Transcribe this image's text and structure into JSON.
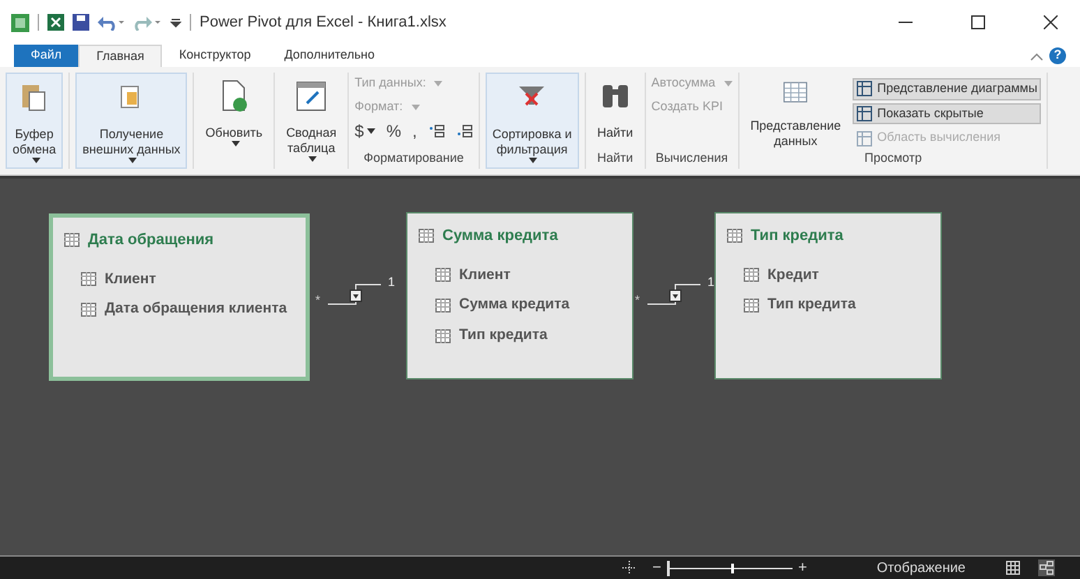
{
  "window": {
    "title": "Power Pivot для Excel - Книга1.xlsx",
    "help": "?"
  },
  "tabs": [
    {
      "label": "Файл",
      "kind": "file",
      "selected": false
    },
    {
      "label": "Главная",
      "kind": "tab",
      "selected": true
    },
    {
      "label": "Конструктор",
      "kind": "tab",
      "selected": false
    },
    {
      "label": "Дополнительно",
      "kind": "tab",
      "selected": false
    }
  ],
  "ribbon": {
    "groups": [
      {
        "controls": [
          {
            "kind": "large",
            "label": "Буфер\nобмена",
            "dropdown": true,
            "highlighted": true
          }
        ]
      },
      {
        "controls": [
          {
            "kind": "large",
            "label": "Получение\nвнешних данных",
            "dropdown": true,
            "highlighted": true
          }
        ]
      },
      {
        "controls": [
          {
            "kind": "large",
            "label": "Обновить",
            "dropdown": true,
            "highlighted": false
          }
        ]
      },
      {
        "controls": [
          {
            "kind": "large",
            "label": "Сводная\nтаблица",
            "dropdown": true,
            "highlighted": false
          }
        ]
      },
      {
        "label": "Форматирование",
        "controls": [
          {
            "kind": "small",
            "label": "Тип данных:",
            "dropdown": true,
            "disabled": true
          },
          {
            "kind": "small",
            "label": "Формат:",
            "dropdown": true,
            "disabled": true
          },
          {
            "kind": "symbols",
            "symbols": [
              "$",
              "%",
              ","
            ]
          }
        ]
      },
      {
        "controls": [
          {
            "kind": "large",
            "label": "Сортировка и\nфильтрация",
            "dropdown": true,
            "highlighted": true
          }
        ]
      },
      {
        "label": "Найти",
        "controls": [
          {
            "kind": "large",
            "label": "Найти",
            "dropdown": false,
            "highlighted": false
          }
        ]
      },
      {
        "label": "Вычисления",
        "controls": [
          {
            "kind": "small",
            "label": "Автосумма",
            "dropdown": true,
            "disabled": true
          },
          {
            "kind": "small",
            "label": "Создать KPI",
            "dropdown": false,
            "disabled": true
          }
        ]
      },
      {
        "label": "Просмотр",
        "controls": [
          {
            "kind": "large",
            "label": "Представление\nданных",
            "dropdown": false,
            "highlighted": false
          },
          {
            "kind": "toggles",
            "items": [
              {
                "label": "Представление диаграммы",
                "selected": true,
                "disabled": false
              },
              {
                "label": "Показать скрытые",
                "selected": true,
                "disabled": false
              },
              {
                "label": "Область вычисления",
                "selected": false,
                "disabled": true
              }
            ]
          }
        ]
      }
    ]
  },
  "diagram": {
    "tables": [
      {
        "name": "Дата обращения",
        "selected": true,
        "columns": [
          "Клиент",
          "Дата обращения клиента"
        ]
      },
      {
        "name": "Сумма кредита",
        "selected": false,
        "columns": [
          "Клиент",
          "Сумма кредита",
          "Тип кредита"
        ]
      },
      {
        "name": "Тип кредита",
        "selected": false,
        "columns": [
          "Кредит",
          "Тип кредита"
        ]
      }
    ],
    "relationships": [
      {
        "many": "*",
        "one": "1"
      },
      {
        "many": "*",
        "one": "1"
      }
    ]
  },
  "status_bar": {
    "zoom": {
      "minus": "−",
      "plus": "+",
      "level": 0.5
    },
    "view_label": "Отображение",
    "views": [
      {
        "kind": "grid",
        "selected": false
      },
      {
        "kind": "diagram",
        "selected": true
      }
    ]
  }
}
